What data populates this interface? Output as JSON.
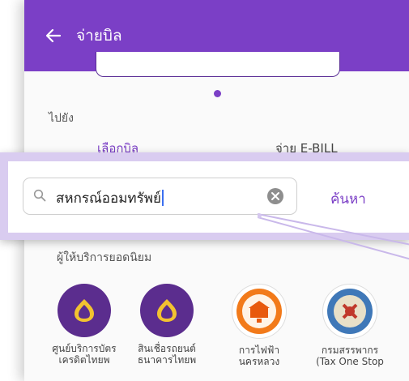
{
  "appbar": {
    "title": "จ่ายบิล",
    "color": "#7b3fc6"
  },
  "goto_label": "ไปยัง",
  "tabs": [
    {
      "label": "เลือกบิล",
      "active": true
    },
    {
      "label": "จ่าย E-BILL",
      "active": false
    }
  ],
  "search": {
    "value": "สหกรณ์ออมทรัพย์",
    "button_label": "ค้นหา"
  },
  "popular": {
    "label": "ผู้ให้บริการยอดนิยม",
    "billers": [
      {
        "line1": "ศูนย์บริการบัตร",
        "line2": "เครดิตไทยพ",
        "icon": "bank-logo-icon"
      },
      {
        "line1": "สินเชื่อรถยนต์",
        "line2": "ธนาคารไทยพ",
        "icon": "bank-logo-icon"
      },
      {
        "line1": "การไฟฟ้า",
        "line2": "นครหลวง",
        "icon": "mea-logo-icon"
      },
      {
        "line1": "กรมสรรพากร",
        "line2": "(Tax One Stop",
        "icon": "revenue-dept-logo-icon"
      }
    ]
  }
}
